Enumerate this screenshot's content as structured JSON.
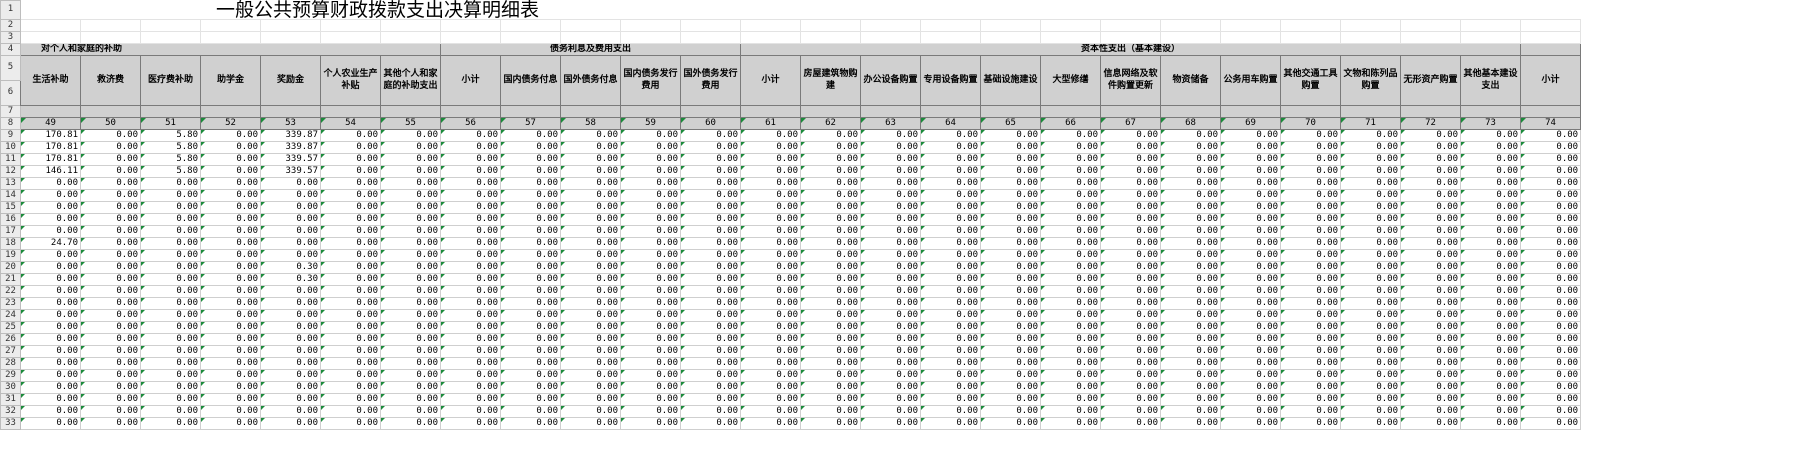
{
  "sheet": {
    "title": "一般公共预算财政拨款支出决算明细表",
    "row_numbers": [
      "1",
      "2",
      "3",
      "4",
      "5",
      "6",
      "7",
      "8",
      "9",
      "10",
      "11",
      "12",
      "13",
      "14",
      "15",
      "16",
      "17",
      "18",
      "19",
      "20",
      "21",
      "22",
      "23",
      "24",
      "25",
      "26",
      "27",
      "28",
      "29",
      "30",
      "31",
      "32",
      "33"
    ],
    "groups": [
      {
        "label": "对个人和家庭的补助",
        "span": 7,
        "align": "left"
      },
      {
        "label": "债务利息及费用支出",
        "span": 5,
        "align": "center"
      },
      {
        "label": "资本性支出（基本建设）",
        "span": 13,
        "align": "center"
      },
      {
        "label": "",
        "span": 1,
        "align": "center"
      }
    ],
    "columns": [
      {
        "label": "生活补助",
        "index": "49"
      },
      {
        "label": "救济费",
        "index": "50"
      },
      {
        "label": "医疗费补助",
        "index": "51"
      },
      {
        "label": "助学金",
        "index": "52"
      },
      {
        "label": "奖励金",
        "index": "53"
      },
      {
        "label": "个人农业生产补贴",
        "index": "54"
      },
      {
        "label": "其他个人和家庭的补助支出",
        "index": "55"
      },
      {
        "label": "小计",
        "index": "56"
      },
      {
        "label": "国内债务付息",
        "index": "57"
      },
      {
        "label": "国外债务付息",
        "index": "58"
      },
      {
        "label": "国内债务发行费用",
        "index": "59"
      },
      {
        "label": "国外债务发行费用",
        "index": "60"
      },
      {
        "label": "小计",
        "index": "61"
      },
      {
        "label": "房屋建筑物购建",
        "index": "62"
      },
      {
        "label": "办公设备购置",
        "index": "63"
      },
      {
        "label": "专用设备购置",
        "index": "64"
      },
      {
        "label": "基础设施建设",
        "index": "65"
      },
      {
        "label": "大型修缮",
        "index": "66"
      },
      {
        "label": "信息网络及软件购置更新",
        "index": "67"
      },
      {
        "label": "物资储备",
        "index": "68"
      },
      {
        "label": "公务用车购置",
        "index": "69"
      },
      {
        "label": "其他交通工具购置",
        "index": "70"
      },
      {
        "label": "文物和陈列品购置",
        "index": "71"
      },
      {
        "label": "无形资产购置",
        "index": "72"
      },
      {
        "label": "其他基本建设支出",
        "index": "73"
      },
      {
        "label": "小计",
        "index": "74"
      }
    ],
    "zero_value": "0.00",
    "data_rows": [
      [
        "170.81",
        "0.00",
        "5.80",
        "0.00",
        "339.87",
        "0.00",
        "0.00"
      ],
      [
        "170.81",
        "0.00",
        "5.80",
        "0.00",
        "339.87",
        "0.00",
        "0.00"
      ],
      [
        "170.81",
        "0.00",
        "5.80",
        "0.00",
        "339.57",
        "0.00",
        "0.00"
      ],
      [
        "146.11",
        "0.00",
        "5.80",
        "0.00",
        "339.57",
        "0.00",
        "0.00"
      ],
      [
        "0.00",
        "0.00",
        "0.00",
        "0.00",
        "0.00",
        "0.00",
        "0.00"
      ],
      [
        "0.00",
        "0.00",
        "0.00",
        "0.00",
        "0.00",
        "0.00",
        "0.00"
      ],
      [
        "0.00",
        "0.00",
        "0.00",
        "0.00",
        "0.00",
        "0.00",
        "0.00"
      ],
      [
        "0.00",
        "0.00",
        "0.00",
        "0.00",
        "0.00",
        "0.00",
        "0.00"
      ],
      [
        "0.00",
        "0.00",
        "0.00",
        "0.00",
        "0.00",
        "0.00",
        "0.00"
      ],
      [
        "24.70",
        "0.00",
        "0.00",
        "0.00",
        "0.00",
        "0.00",
        "0.00"
      ],
      [
        "0.00",
        "0.00",
        "0.00",
        "0.00",
        "0.00",
        "0.00",
        "0.00"
      ],
      [
        "0.00",
        "0.00",
        "0.00",
        "0.00",
        "0.30",
        "0.00",
        "0.00"
      ],
      [
        "0.00",
        "0.00",
        "0.00",
        "0.00",
        "0.30",
        "0.00",
        "0.00"
      ],
      [
        "0.00",
        "0.00",
        "0.00",
        "0.00",
        "0.00",
        "0.00",
        "0.00"
      ],
      [
        "0.00",
        "0.00",
        "0.00",
        "0.00",
        "0.00",
        "0.00",
        "0.00"
      ],
      [
        "0.00",
        "0.00",
        "0.00",
        "0.00",
        "0.00",
        "0.00",
        "0.00"
      ],
      [
        "0.00",
        "0.00",
        "0.00",
        "0.00",
        "0.00",
        "0.00",
        "0.00"
      ],
      [
        "0.00",
        "0.00",
        "0.00",
        "0.00",
        "0.00",
        "0.00",
        "0.00"
      ],
      [
        "0.00",
        "0.00",
        "0.00",
        "0.00",
        "0.00",
        "0.00",
        "0.00"
      ],
      [
        "0.00",
        "0.00",
        "0.00",
        "0.00",
        "0.00",
        "0.00",
        "0.00"
      ],
      [
        "0.00",
        "0.00",
        "0.00",
        "0.00",
        "0.00",
        "0.00",
        "0.00"
      ],
      [
        "0.00",
        "0.00",
        "0.00",
        "0.00",
        "0.00",
        "0.00",
        "0.00"
      ],
      [
        "0.00",
        "0.00",
        "0.00",
        "0.00",
        "0.00",
        "0.00",
        "0.00"
      ],
      [
        "0.00",
        "0.00",
        "0.00",
        "0.00",
        "0.00",
        "0.00",
        "0.00"
      ],
      [
        "0.00",
        "0.00",
        "0.00",
        "0.00",
        "0.00",
        "0.00",
        "0.00"
      ]
    ]
  }
}
